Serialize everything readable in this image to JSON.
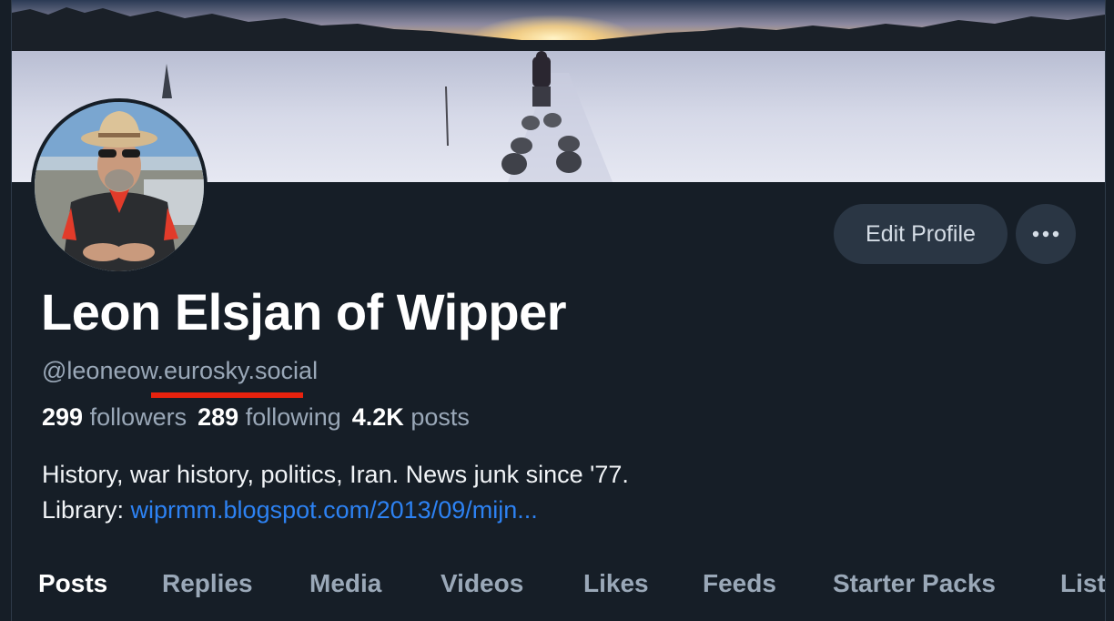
{
  "profile": {
    "display_name": "Leon Elsjan of Wipper",
    "handle": "@leoneow.eurosky.social",
    "followers_count": "299",
    "followers_label": "followers",
    "following_count": "289",
    "following_label": "following",
    "posts_count": "4.2K",
    "posts_label": "posts",
    "bio_line1": "History, war history, politics, Iran. News junk since '77.",
    "bio_line2_prefix": "Library: ",
    "bio_link": "wiprmm.blogspot.com/2013/09/mijn..."
  },
  "actions": {
    "edit_profile_label": "Edit Profile",
    "more_icon": "ellipsis-icon"
  },
  "tabs": [
    {
      "label": "Posts"
    },
    {
      "label": "Replies"
    },
    {
      "label": "Media"
    },
    {
      "label": "Videos"
    },
    {
      "label": "Likes"
    },
    {
      "label": "Feeds"
    },
    {
      "label": "Starter Packs"
    },
    {
      "label": "Lists"
    }
  ],
  "colors": {
    "background": "#161e27",
    "button": "#2a3644",
    "link": "#2d82f3",
    "muted_text": "#9aa8b8",
    "highlight_underline": "#e8220e"
  }
}
